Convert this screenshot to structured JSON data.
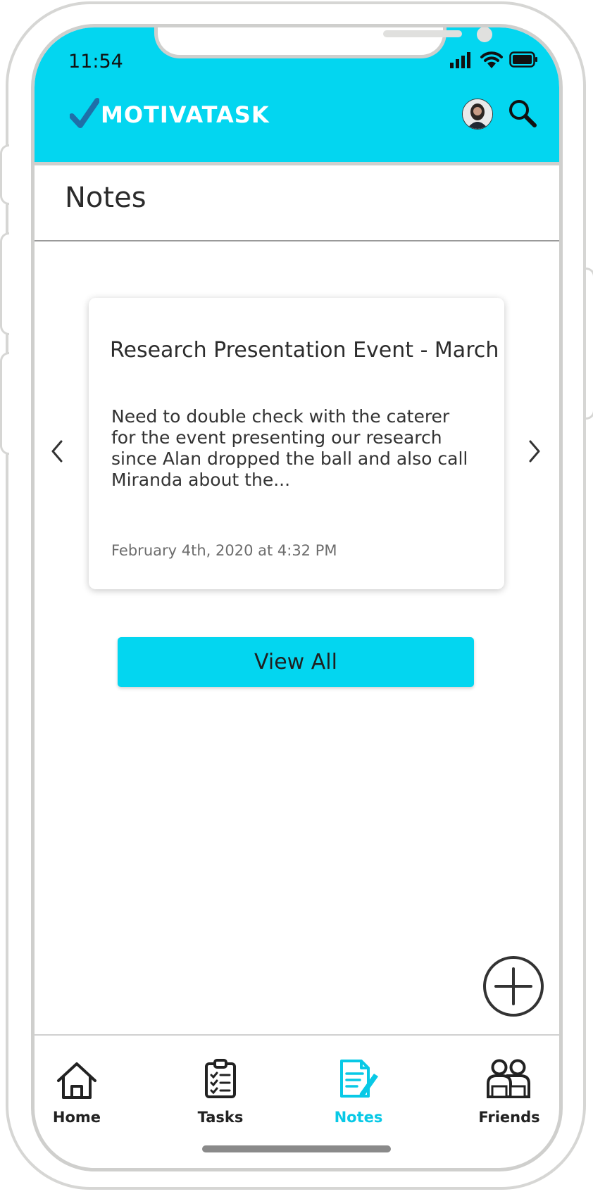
{
  "status_bar": {
    "time": "11:54"
  },
  "header": {
    "brand": "MOTIVATASK"
  },
  "page": {
    "title": "Notes"
  },
  "note": {
    "title": "Research Presentation Event - March",
    "body": "Need to double check with the caterer for the event presenting our research since Alan dropped the ball and also call Miranda about the...",
    "date": "February 4th, 2020 at 4:32 PM"
  },
  "actions": {
    "view_all": "View All"
  },
  "nav": {
    "items": [
      {
        "label": "Home",
        "icon": "home-icon",
        "active": false
      },
      {
        "label": "Tasks",
        "icon": "clipboard-icon",
        "active": false
      },
      {
        "label": "Notes",
        "icon": "notepad-pencil-icon",
        "active": true
      },
      {
        "label": "Friends",
        "icon": "people-icon",
        "active": false
      }
    ]
  },
  "colors": {
    "accent": "#03d6f0",
    "check": "#1f6fa8",
    "nav_active": "#08c9e6"
  }
}
